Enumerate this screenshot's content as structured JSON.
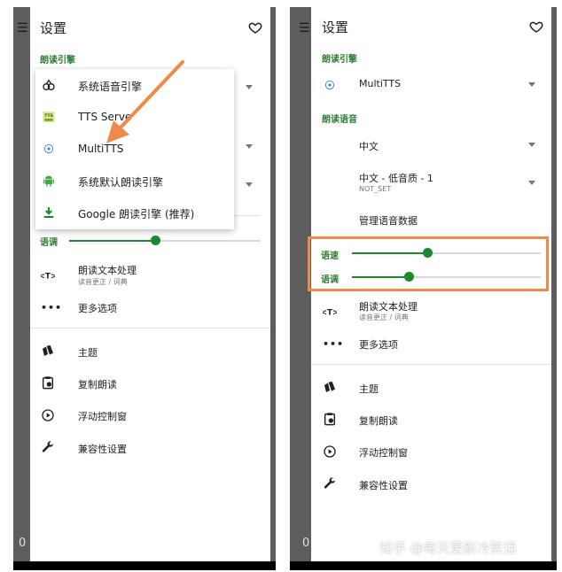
{
  "colors": {
    "accent": "#1b8a2e",
    "section": "#2e7d32",
    "annotation": "#f08a4b"
  },
  "left": {
    "title": "设置",
    "bg_zero": "0",
    "section_engine": "朗读引擎",
    "menu": [
      {
        "label": "系统语音引擎",
        "icon": "voice-engine-icon"
      },
      {
        "label": "TTS Serve",
        "icon": "tts-server-icon"
      },
      {
        "label": "MultiTTS",
        "icon": "multitts-icon"
      },
      {
        "label": "系统默认朗读引擎",
        "icon": "android-icon"
      },
      {
        "label": "Google 朗读引擎 (推荐)",
        "icon": "download-icon"
      }
    ],
    "pitch_label": "语调",
    "pitch_level": 0.45,
    "text_processing": "朗读文本处理",
    "text_processing_sub": "读音更正 / 词典",
    "more_options": "更多选项",
    "theme": "主题",
    "copy_read": "复制朗读",
    "float_control": "浮动控制窗",
    "compat": "兼容性设置"
  },
  "right": {
    "title": "设置",
    "bg_zero": "0",
    "section_engine": "朗读引擎",
    "engine_value": "MultiTTS",
    "section_voice": "朗读语音",
    "language": "中文",
    "voice": "中文 - 低音质 - 1",
    "voice_sub": "NOT_SET",
    "manage_voice": "管理语音数据",
    "rate_label": "语速",
    "rate_level": 0.4,
    "pitch_label": "语调",
    "pitch_level": 0.3,
    "text_processing": "朗读文本处理",
    "text_processing_sub": "读音更正 / 词典",
    "more_options": "更多选项",
    "theme": "主题",
    "copy_read": "复制朗读",
    "float_control": "浮动控制窗",
    "compat": "兼容性设置"
  },
  "watermark": "知乎 @每天更新冷笑话"
}
